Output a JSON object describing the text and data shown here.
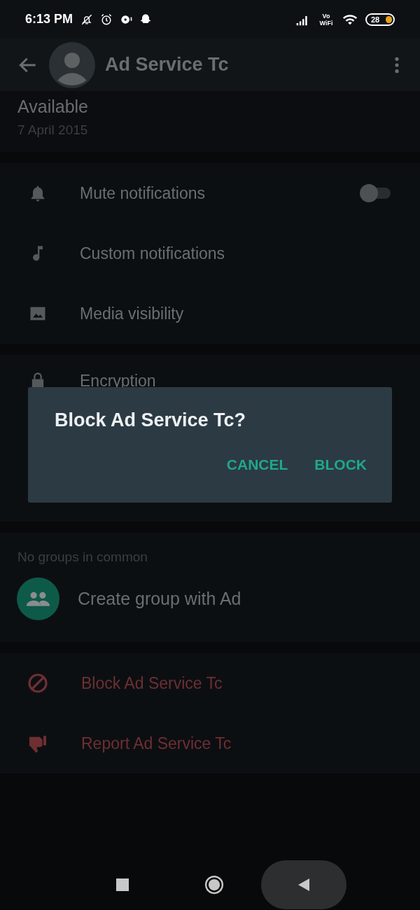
{
  "status_bar": {
    "time": "6:13 PM",
    "network_label": "Vo WiFi",
    "battery": "28"
  },
  "app_bar": {
    "title": "Ad Service Tc"
  },
  "about": {
    "status": "Available",
    "date": "7 April 2015"
  },
  "settings": [
    {
      "label": "Mute notifications",
      "kind": "toggle",
      "on": false
    },
    {
      "label": "Custom notifications",
      "kind": "plain"
    },
    {
      "label": "Media visibility",
      "kind": "plain"
    }
  ],
  "security": {
    "title": "Encryption"
  },
  "groups": {
    "header": "No groups in common",
    "create_label": "Create group with Ad"
  },
  "danger_actions": [
    "Block Ad Service Tc",
    "Report Ad Service Tc"
  ],
  "dialog": {
    "title": "Block Ad Service Tc?",
    "buttons": [
      "CANCEL",
      "BLOCK"
    ]
  }
}
